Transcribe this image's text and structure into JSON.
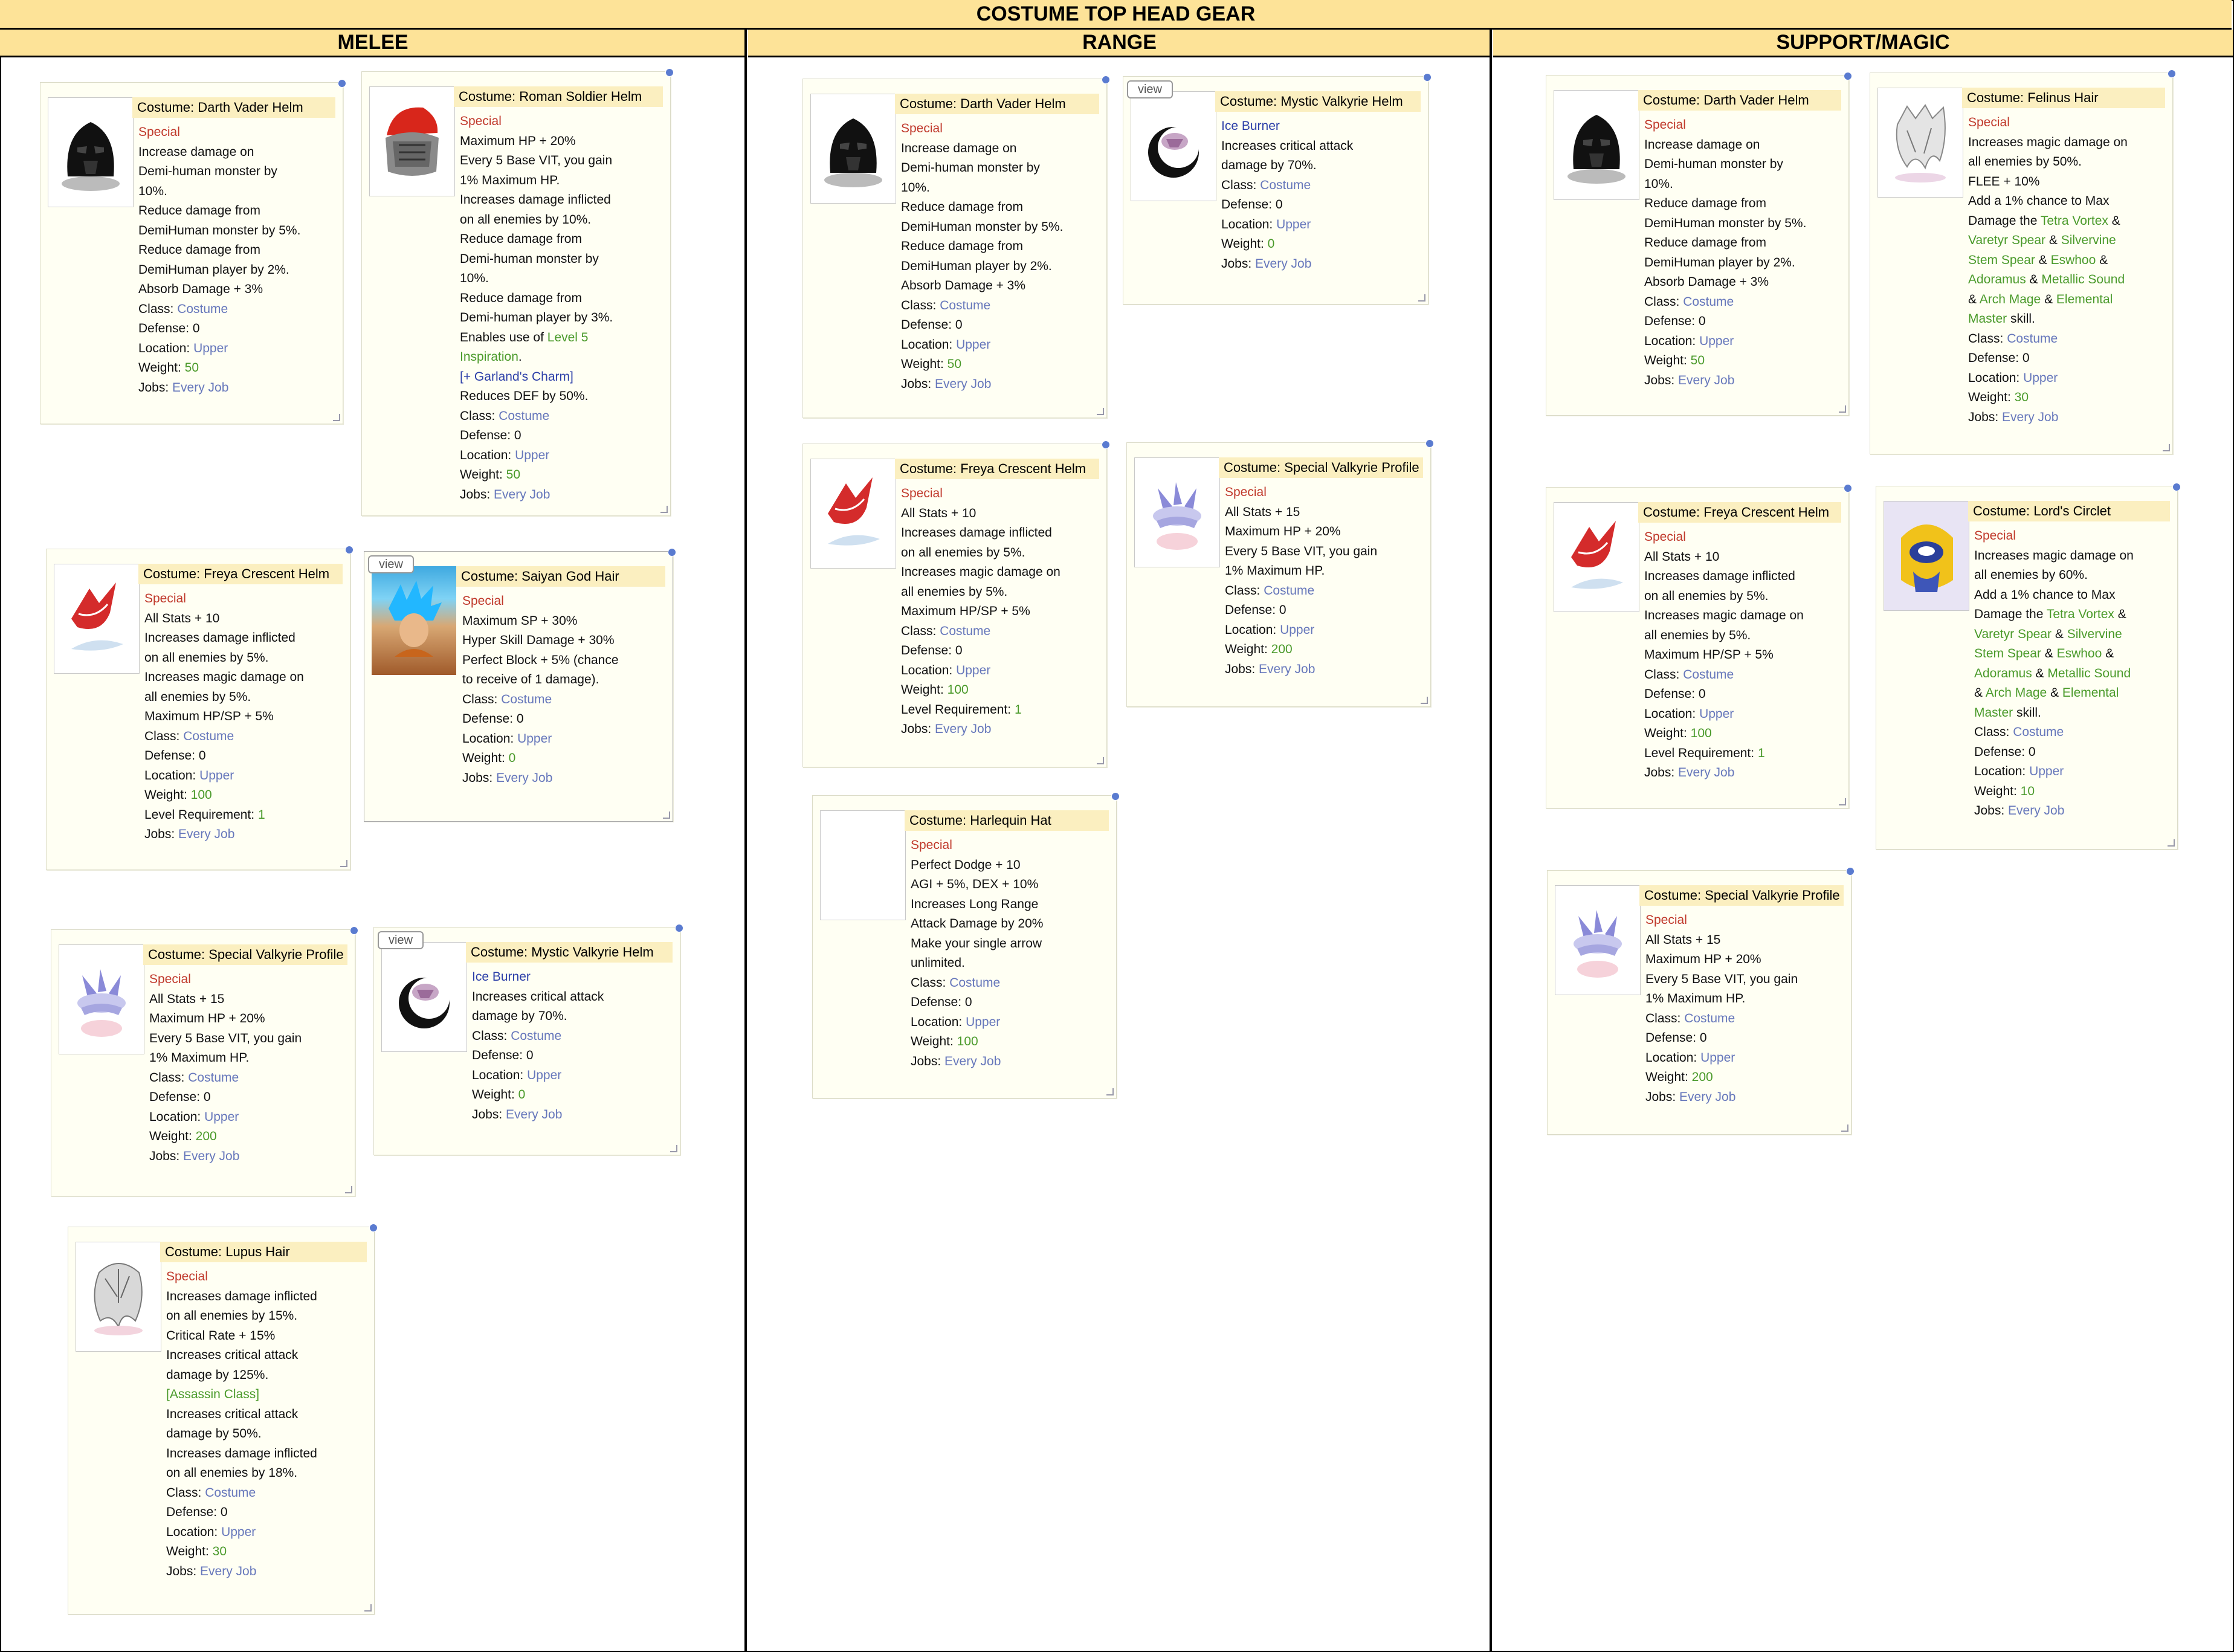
{
  "title": "COSTUME TOP HEAD GEAR",
  "columns": [
    "MELEE",
    "RANGE",
    "SUPPORT/MAGIC"
  ],
  "view_label": "view",
  "common": {
    "special": "Special",
    "class_label": "Class:",
    "class_value": "Costume",
    "defense_label": "Defense:",
    "defense_value": "0",
    "location_label": "Location:",
    "location_value": "Upper",
    "weight_label": "Weight:",
    "jobs_label": "Jobs:",
    "jobs_value": "Every Job",
    "level_label": "Level Requirement:",
    "level_value": "1"
  },
  "items": {
    "darth": {
      "name": "Costume: Darth Vader Helm",
      "lines": [
        "Increase damage on",
        "Demi-human monster by",
        "10%.",
        "Reduce damage from",
        "DemiHuman monster by 5%.",
        "Reduce damage from",
        "DemiHuman player by 2%.",
        "Absorb Damage + 3%"
      ],
      "weight": "50"
    },
    "roman": {
      "name": "Costume: Roman Soldier Helm",
      "lines": [
        "Maximum HP + 20%",
        "Every 5 Base VIT, you gain",
        "1% Maximum HP.",
        "Increases damage inflicted",
        "on all enemies by 10%.",
        "Reduce damage from",
        "Demi-human monster by",
        "10%.",
        "Reduce damage from",
        "Demi-human player by 3%."
      ],
      "enables_prefix": "Enables use of ",
      "enables_link": "Level 5",
      "enables_link2": "Inspiration",
      "enables_suffix": ".",
      "charm": "[+ Garland's Charm]",
      "charm_line": "Reduces DEF by 50%.",
      "weight": "50"
    },
    "freya": {
      "name": "Costume: Freya Crescent Helm",
      "lines": [
        "All Stats + 10",
        "Increases damage inflicted",
        "on all enemies by 5%.",
        "Increases magic damage on",
        "all enemies by 5%.",
        "Maximum HP/SP + 5%"
      ],
      "weight": "100"
    },
    "saiyan": {
      "name": "Costume: Saiyan God Hair",
      "lines": [
        "Maximum SP + 30%",
        "Hyper Skill Damage + 30%",
        "Perfect Block + 5% (chance",
        "to receive of 1 damage)."
      ],
      "weight": "0"
    },
    "valk_profile": {
      "name": "Costume: Special Valkyrie Profile",
      "lines": [
        "All Stats + 15",
        "Maximum HP + 20%",
        "Every 5 Base VIT, you gain",
        "1% Maximum HP."
      ],
      "weight": "200"
    },
    "mystic": {
      "name": "Costume: Mystic Valkyrie Helm",
      "subtitle": "Ice Burner",
      "lines": [
        "Increases critical attack",
        "damage by 70%."
      ],
      "weight": "0"
    },
    "lupus": {
      "name": "Costume: Lupus Hair",
      "lines": [
        "Increases damage inflicted",
        "on all enemies by 15%.",
        "Critical Rate + 15%",
        "Increases critical attack",
        "damage by 125%."
      ],
      "assassin": "[Assassin Class]",
      "lines2": [
        "Increases critical attack",
        "damage by 50%.",
        "Increases damage inflicted",
        "on all enemies by 18%."
      ],
      "weight": "30"
    },
    "harlequin": {
      "name": "Costume: Harlequin Hat",
      "lines": [
        "Perfect Dodge + 10",
        "AGI + 5%, DEX + 10%",
        "Increases Long Range",
        "Attack Damage by 20%",
        "Make your single arrow",
        "unlimited."
      ],
      "weight": "100"
    },
    "felinus": {
      "name": "Costume: Felinus Hair",
      "lines": [
        "Increases magic damage on",
        "all enemies by 50%.",
        "FLEE + 10%",
        "Add a 1% chance to Max"
      ],
      "weight": "30"
    },
    "lords": {
      "name": "Costume: Lord's Circlet",
      "lines": [
        "Increases magic damage on",
        "all enemies by 60%.",
        "Add a 1% chance to Max"
      ],
      "weight": "10"
    },
    "max_damage": {
      "p1": "Damage the ",
      "tetra": "Tetra Vortex",
      "amp": " & ",
      "varetyr": "Varetyr Spear",
      "silvervine": "Silvervine",
      "stem": "Stem Spear",
      "eswhoo": "Eswhoo",
      "adoramus": "Adoramus",
      "metallic": "Metallic Sound",
      "arch": "Arch Mage",
      "elemental": "Elemental",
      "master": "Master",
      "skill": " skill."
    }
  }
}
